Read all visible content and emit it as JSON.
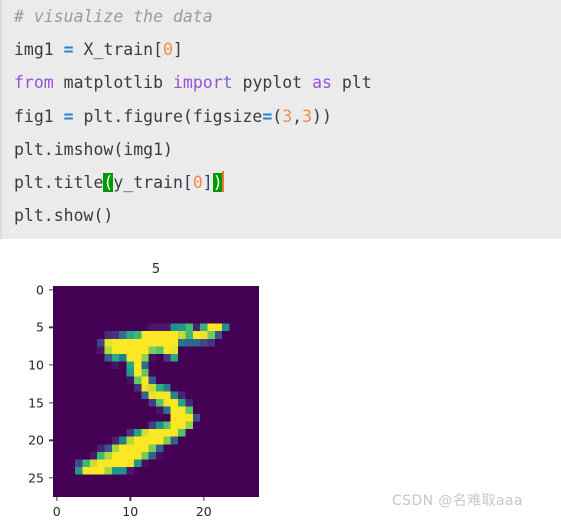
{
  "code_cell": {
    "background_color": "#ebebeb",
    "lines": [
      {
        "id": "line-1",
        "text": "# visualize the data",
        "tokens": [
          {
            "t": "# visualize the data",
            "c": "comment"
          }
        ]
      },
      {
        "id": "line-2",
        "text": "img1 = X_train[0]",
        "tokens": [
          {
            "t": "img1 ",
            "c": "plain"
          },
          {
            "t": "=",
            "c": "op"
          },
          {
            "t": " X_train",
            "c": "plain"
          },
          {
            "t": "[",
            "c": "brk"
          },
          {
            "t": "0",
            "c": "num"
          },
          {
            "t": "]",
            "c": "brk"
          }
        ]
      },
      {
        "id": "line-3",
        "text": "from matplotlib import pyplot as plt",
        "tokens": [
          {
            "t": "from",
            "c": "kw"
          },
          {
            "t": " matplotlib ",
            "c": "plain"
          },
          {
            "t": "import",
            "c": "kw"
          },
          {
            "t": " pyplot ",
            "c": "plain"
          },
          {
            "t": "as",
            "c": "kw"
          },
          {
            "t": " plt",
            "c": "plain"
          }
        ]
      },
      {
        "id": "line-4",
        "text": "fig1 = plt.figure(figsize=(3,3))",
        "tokens": [
          {
            "t": "fig1 ",
            "c": "plain"
          },
          {
            "t": "=",
            "c": "op"
          },
          {
            "t": " plt.figure(figsize",
            "c": "plain"
          },
          {
            "t": "=",
            "c": "op"
          },
          {
            "t": "(",
            "c": "plain"
          },
          {
            "t": "3",
            "c": "num"
          },
          {
            "t": ",",
            "c": "plain"
          },
          {
            "t": "3",
            "c": "num"
          },
          {
            "t": "))",
            "c": "plain"
          }
        ]
      },
      {
        "id": "line-5",
        "text": "plt.imshow(img1)",
        "tokens": [
          {
            "t": "plt.imshow(img1)",
            "c": "plain"
          }
        ]
      },
      {
        "id": "line-6",
        "text": "plt.title(y_train[0])",
        "tokens": [
          {
            "t": "plt.title",
            "c": "plain"
          },
          {
            "t": "(",
            "c": "match"
          },
          {
            "t": "y_train",
            "c": "plain"
          },
          {
            "t": "[",
            "c": "brk"
          },
          {
            "t": "0",
            "c": "num"
          },
          {
            "t": "]",
            "c": "brk"
          },
          {
            "t": ")",
            "c": "match"
          },
          {
            "t": "",
            "c": "caret"
          }
        ]
      },
      {
        "id": "line-7",
        "text": "plt.show()",
        "tokens": [
          {
            "t": "plt.show()",
            "c": "plain"
          }
        ]
      }
    ]
  },
  "figure": {
    "title": "5",
    "colormap": "viridis",
    "background_color": "#ffffff"
  },
  "chart_data": {
    "type": "heatmap",
    "title": "5",
    "xlabel": "",
    "ylabel": "",
    "colormap": "viridis",
    "vmin": 0,
    "vmax": 255,
    "grid": false,
    "legend": "none",
    "xlim": [
      -0.5,
      27.5
    ],
    "ylim": [
      27.5,
      -0.5
    ],
    "xticks": [
      0,
      10,
      20
    ],
    "xtick_labels": [
      "0",
      "10",
      "20"
    ],
    "yticks": [
      0,
      5,
      10,
      15,
      20,
      25
    ],
    "ytick_labels": [
      "0",
      "5",
      "10",
      "15",
      "20",
      "25"
    ],
    "shape": [
      28,
      28
    ],
    "description": "MNIST training image index 0, a handwritten digit 5",
    "values": [
      [
        0,
        0,
        0,
        0,
        0,
        0,
        0,
        0,
        0,
        0,
        0,
        0,
        0,
        0,
        0,
        0,
        0,
        0,
        0,
        0,
        0,
        0,
        0,
        0,
        0,
        0,
        0,
        0
      ],
      [
        0,
        0,
        0,
        0,
        0,
        0,
        0,
        0,
        0,
        0,
        0,
        0,
        0,
        0,
        0,
        0,
        0,
        0,
        0,
        0,
        0,
        0,
        0,
        0,
        0,
        0,
        0,
        0
      ],
      [
        0,
        0,
        0,
        0,
        0,
        0,
        0,
        0,
        0,
        0,
        0,
        0,
        0,
        0,
        0,
        0,
        0,
        0,
        0,
        0,
        0,
        0,
        0,
        0,
        0,
        0,
        0,
        0
      ],
      [
        0,
        0,
        0,
        0,
        0,
        0,
        0,
        0,
        0,
        0,
        0,
        0,
        0,
        0,
        0,
        0,
        0,
        0,
        0,
        0,
        0,
        0,
        0,
        0,
        0,
        0,
        0,
        0
      ],
      [
        0,
        0,
        0,
        0,
        0,
        0,
        0,
        0,
        0,
        0,
        0,
        0,
        0,
        0,
        0,
        0,
        0,
        0,
        0,
        0,
        0,
        0,
        0,
        0,
        0,
        0,
        0,
        0
      ],
      [
        0,
        0,
        0,
        0,
        0,
        0,
        0,
        0,
        0,
        0,
        0,
        0,
        3,
        18,
        18,
        18,
        126,
        136,
        175,
        26,
        166,
        255,
        247,
        127,
        0,
        0,
        0,
        0
      ],
      [
        0,
        0,
        0,
        0,
        0,
        0,
        0,
        30,
        36,
        94,
        154,
        170,
        253,
        253,
        253,
        253,
        253,
        225,
        172,
        253,
        242,
        195,
        64,
        0,
        0,
        0,
        0,
        0
      ],
      [
        0,
        0,
        0,
        0,
        0,
        0,
        49,
        238,
        253,
        253,
        253,
        253,
        253,
        253,
        253,
        253,
        251,
        93,
        82,
        82,
        56,
        39,
        0,
        0,
        0,
        0,
        0,
        0
      ],
      [
        0,
        0,
        0,
        0,
        0,
        0,
        18,
        219,
        253,
        253,
        253,
        253,
        253,
        198,
        182,
        247,
        241,
        0,
        0,
        0,
        0,
        0,
        0,
        0,
        0,
        0,
        0,
        0
      ],
      [
        0,
        0,
        0,
        0,
        0,
        0,
        0,
        80,
        156,
        107,
        253,
        253,
        205,
        11,
        0,
        43,
        154,
        0,
        0,
        0,
        0,
        0,
        0,
        0,
        0,
        0,
        0,
        0
      ],
      [
        0,
        0,
        0,
        0,
        0,
        0,
        0,
        0,
        14,
        1,
        154,
        253,
        90,
        0,
        0,
        0,
        0,
        0,
        0,
        0,
        0,
        0,
        0,
        0,
        0,
        0,
        0,
        0
      ],
      [
        0,
        0,
        0,
        0,
        0,
        0,
        0,
        0,
        0,
        0,
        139,
        253,
        190,
        2,
        0,
        0,
        0,
        0,
        0,
        0,
        0,
        0,
        0,
        0,
        0,
        0,
        0,
        0
      ],
      [
        0,
        0,
        0,
        0,
        0,
        0,
        0,
        0,
        0,
        0,
        11,
        190,
        253,
        70,
        0,
        0,
        0,
        0,
        0,
        0,
        0,
        0,
        0,
        0,
        0,
        0,
        0,
        0
      ],
      [
        0,
        0,
        0,
        0,
        0,
        0,
        0,
        0,
        0,
        0,
        0,
        35,
        241,
        225,
        160,
        108,
        1,
        0,
        0,
        0,
        0,
        0,
        0,
        0,
        0,
        0,
        0,
        0
      ],
      [
        0,
        0,
        0,
        0,
        0,
        0,
        0,
        0,
        0,
        0,
        0,
        0,
        81,
        240,
        253,
        253,
        119,
        25,
        0,
        0,
        0,
        0,
        0,
        0,
        0,
        0,
        0,
        0
      ],
      [
        0,
        0,
        0,
        0,
        0,
        0,
        0,
        0,
        0,
        0,
        0,
        0,
        0,
        45,
        186,
        253,
        253,
        150,
        27,
        0,
        0,
        0,
        0,
        0,
        0,
        0,
        0,
        0
      ],
      [
        0,
        0,
        0,
        0,
        0,
        0,
        0,
        0,
        0,
        0,
        0,
        0,
        0,
        0,
        16,
        93,
        252,
        253,
        187,
        0,
        0,
        0,
        0,
        0,
        0,
        0,
        0,
        0
      ],
      [
        0,
        0,
        0,
        0,
        0,
        0,
        0,
        0,
        0,
        0,
        0,
        0,
        0,
        0,
        0,
        0,
        249,
        253,
        249,
        64,
        0,
        0,
        0,
        0,
        0,
        0,
        0,
        0
      ],
      [
        0,
        0,
        0,
        0,
        0,
        0,
        0,
        0,
        0,
        0,
        0,
        0,
        0,
        46,
        130,
        183,
        253,
        253,
        207,
        2,
        0,
        0,
        0,
        0,
        0,
        0,
        0,
        0
      ],
      [
        0,
        0,
        0,
        0,
        0,
        0,
        0,
        0,
        0,
        0,
        39,
        148,
        229,
        253,
        253,
        253,
        250,
        182,
        0,
        0,
        0,
        0,
        0,
        0,
        0,
        0,
        0,
        0
      ],
      [
        0,
        0,
        0,
        0,
        0,
        0,
        0,
        0,
        24,
        114,
        221,
        253,
        253,
        253,
        253,
        201,
        78,
        0,
        0,
        0,
        0,
        0,
        0,
        0,
        0,
        0,
        0,
        0
      ],
      [
        0,
        0,
        0,
        0,
        0,
        0,
        23,
        66,
        213,
        253,
        253,
        253,
        253,
        198,
        81,
        2,
        0,
        0,
        0,
        0,
        0,
        0,
        0,
        0,
        0,
        0,
        0,
        0
      ],
      [
        0,
        0,
        0,
        0,
        0,
        18,
        171,
        219,
        253,
        253,
        253,
        253,
        195,
        80,
        9,
        0,
        0,
        0,
        0,
        0,
        0,
        0,
        0,
        0,
        0,
        0,
        0,
        0
      ],
      [
        0,
        0,
        0,
        55,
        172,
        226,
        253,
        253,
        253,
        253,
        244,
        133,
        11,
        0,
        0,
        0,
        0,
        0,
        0,
        0,
        0,
        0,
        0,
        0,
        0,
        0,
        0,
        0
      ],
      [
        0,
        0,
        0,
        136,
        253,
        253,
        253,
        212,
        135,
        132,
        16,
        0,
        0,
        0,
        0,
        0,
        0,
        0,
        0,
        0,
        0,
        0,
        0,
        0,
        0,
        0,
        0,
        0
      ],
      [
        0,
        0,
        0,
        0,
        0,
        0,
        0,
        0,
        0,
        0,
        0,
        0,
        0,
        0,
        0,
        0,
        0,
        0,
        0,
        0,
        0,
        0,
        0,
        0,
        0,
        0,
        0,
        0
      ],
      [
        0,
        0,
        0,
        0,
        0,
        0,
        0,
        0,
        0,
        0,
        0,
        0,
        0,
        0,
        0,
        0,
        0,
        0,
        0,
        0,
        0,
        0,
        0,
        0,
        0,
        0,
        0,
        0
      ],
      [
        0,
        0,
        0,
        0,
        0,
        0,
        0,
        0,
        0,
        0,
        0,
        0,
        0,
        0,
        0,
        0,
        0,
        0,
        0,
        0,
        0,
        0,
        0,
        0,
        0,
        0,
        0,
        0
      ]
    ]
  },
  "watermark": {
    "text": "CSDN @名难取aaa"
  }
}
